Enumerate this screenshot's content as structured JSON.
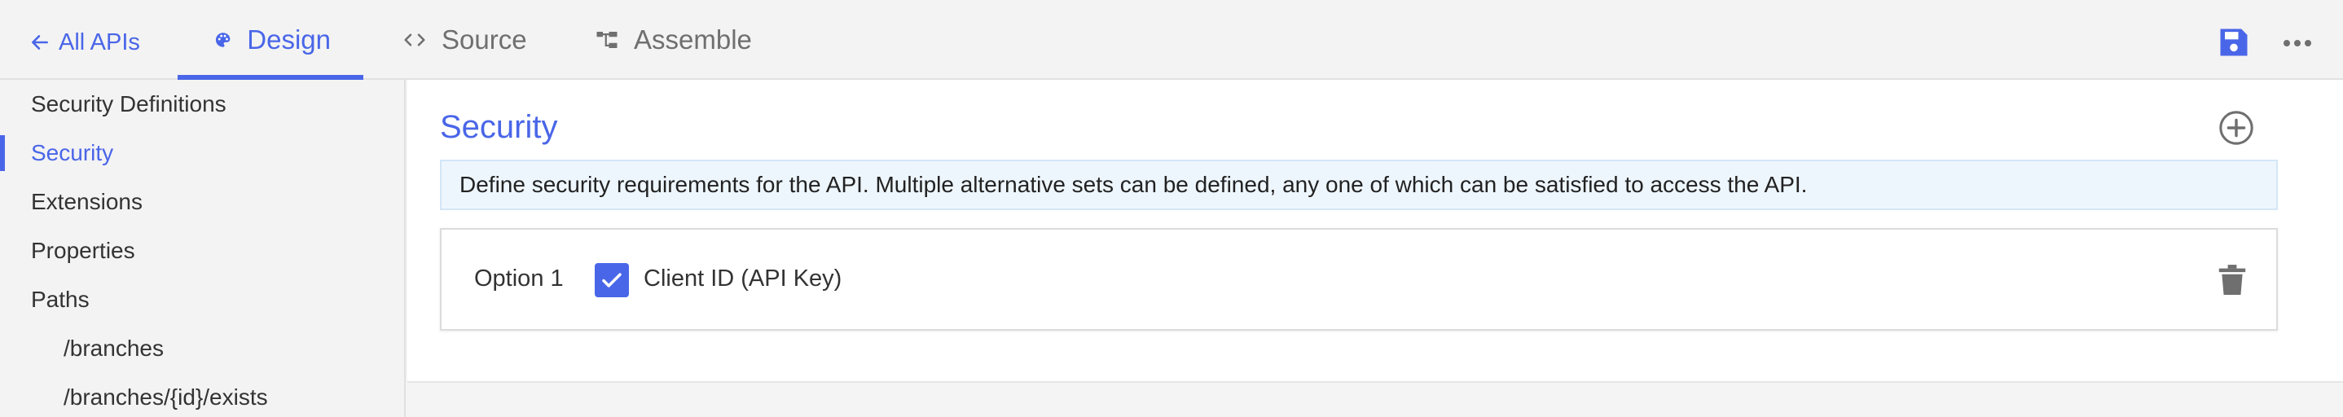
{
  "nav": {
    "back_label": "All APIs",
    "tabs": [
      {
        "label": "Design",
        "icon": "palette-icon",
        "active": true
      },
      {
        "label": "Source",
        "icon": "code-icon",
        "active": false
      },
      {
        "label": "Assemble",
        "icon": "flow-icon",
        "active": false
      }
    ],
    "actions": {
      "save_icon": "save-icon",
      "more_icon": "more-icon"
    }
  },
  "sidebar": {
    "items": [
      {
        "label": "Security Definitions",
        "active": false,
        "sub": false
      },
      {
        "label": "Security",
        "active": true,
        "sub": false
      },
      {
        "label": "Extensions",
        "active": false,
        "sub": false
      },
      {
        "label": "Properties",
        "active": false,
        "sub": false
      },
      {
        "label": "Paths",
        "active": false,
        "sub": false
      },
      {
        "label": "/branches",
        "active": false,
        "sub": true
      },
      {
        "label": "/branches/{id}/exists",
        "active": false,
        "sub": true
      }
    ]
  },
  "main": {
    "title": "Security",
    "info": "Define security requirements for the API. Multiple alternative sets can be defined, any one of which can be satisfied to access the API.",
    "options": [
      {
        "label": "Option 1",
        "checkbox_label": "Client ID (API Key)",
        "checked": true
      }
    ]
  },
  "colors": {
    "accent": "#4a66e8",
    "info_bg": "#eef6fd",
    "text": "#333333"
  }
}
